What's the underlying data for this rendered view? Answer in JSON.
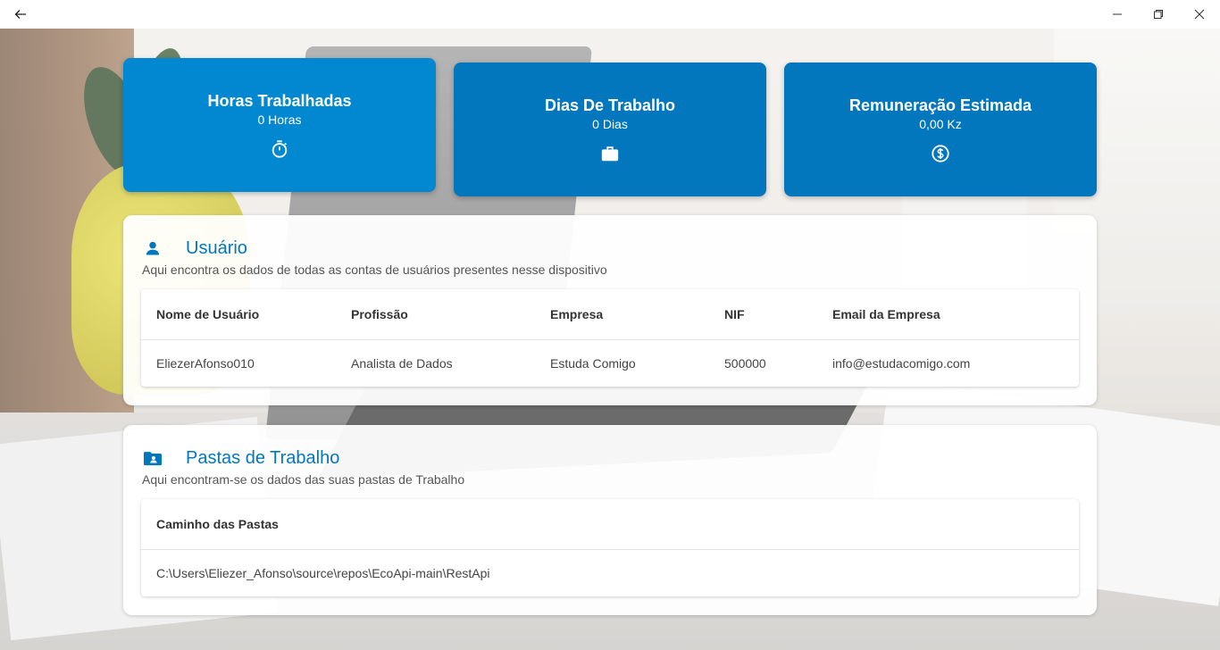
{
  "stats": [
    {
      "title": "Horas Trabalhadas",
      "value": "0 Horas",
      "icon": "stopwatch-icon"
    },
    {
      "title": "Dias De Trabalho",
      "value": "0 Dias",
      "icon": "briefcase-icon"
    },
    {
      "title": "Remuneração Estimada",
      "value": "0,00 Kz",
      "icon": "dollar-coin-icon"
    }
  ],
  "users": {
    "title": "Usuário",
    "subtitle": "Aqui encontra os dados de todas as contas de usuários presentes nesse dispositivo",
    "columns": [
      "Nome de Usuário",
      "Profissão",
      "Empresa",
      "NIF",
      "Email da Empresa"
    ],
    "rows": [
      [
        "EliezerAfonso010",
        "Analista de Dados",
        "Estuda Comigo",
        "500000",
        "info@estudacomigo.com"
      ]
    ]
  },
  "folders": {
    "title": "Pastas de Trabalho",
    "subtitle": "Aqui encontram-se os dados das suas pastas de Trabalho",
    "columns": [
      "Caminho das Pastas"
    ],
    "rows": [
      [
        "C:\\Users\\Eliezer_Afonso\\source\\repos\\EcoApi-main\\RestApi"
      ]
    ]
  },
  "colors": {
    "accent": "#0277bd",
    "accent_active": "#0288d1"
  }
}
